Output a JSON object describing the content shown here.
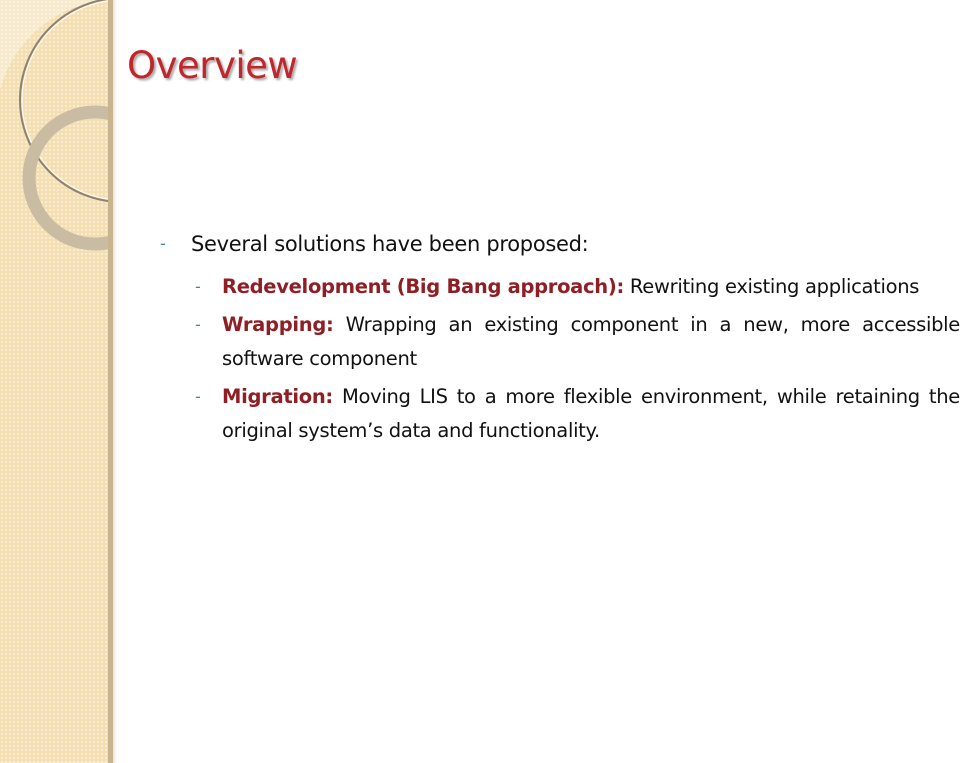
{
  "slide": {
    "title": "Overview",
    "bullet": "Several solutions have been proposed:",
    "dash": "-",
    "items": [
      {
        "term": "Redevelopment (Big Bang approach):",
        "text": "Rewriting existing applications"
      },
      {
        "term": "Wrapping:",
        "text": "Wrapping an existing component in a new, more accessible software component"
      },
      {
        "term": "Migration:",
        "text": "Moving LIS to a more flexible environment, while retaining the original system’s data and functionality."
      }
    ]
  },
  "colors": {
    "title": "#c0262b",
    "term": "#8f1f25",
    "bullet": "#3a8a92",
    "sidebar": "#f4dfb2"
  }
}
